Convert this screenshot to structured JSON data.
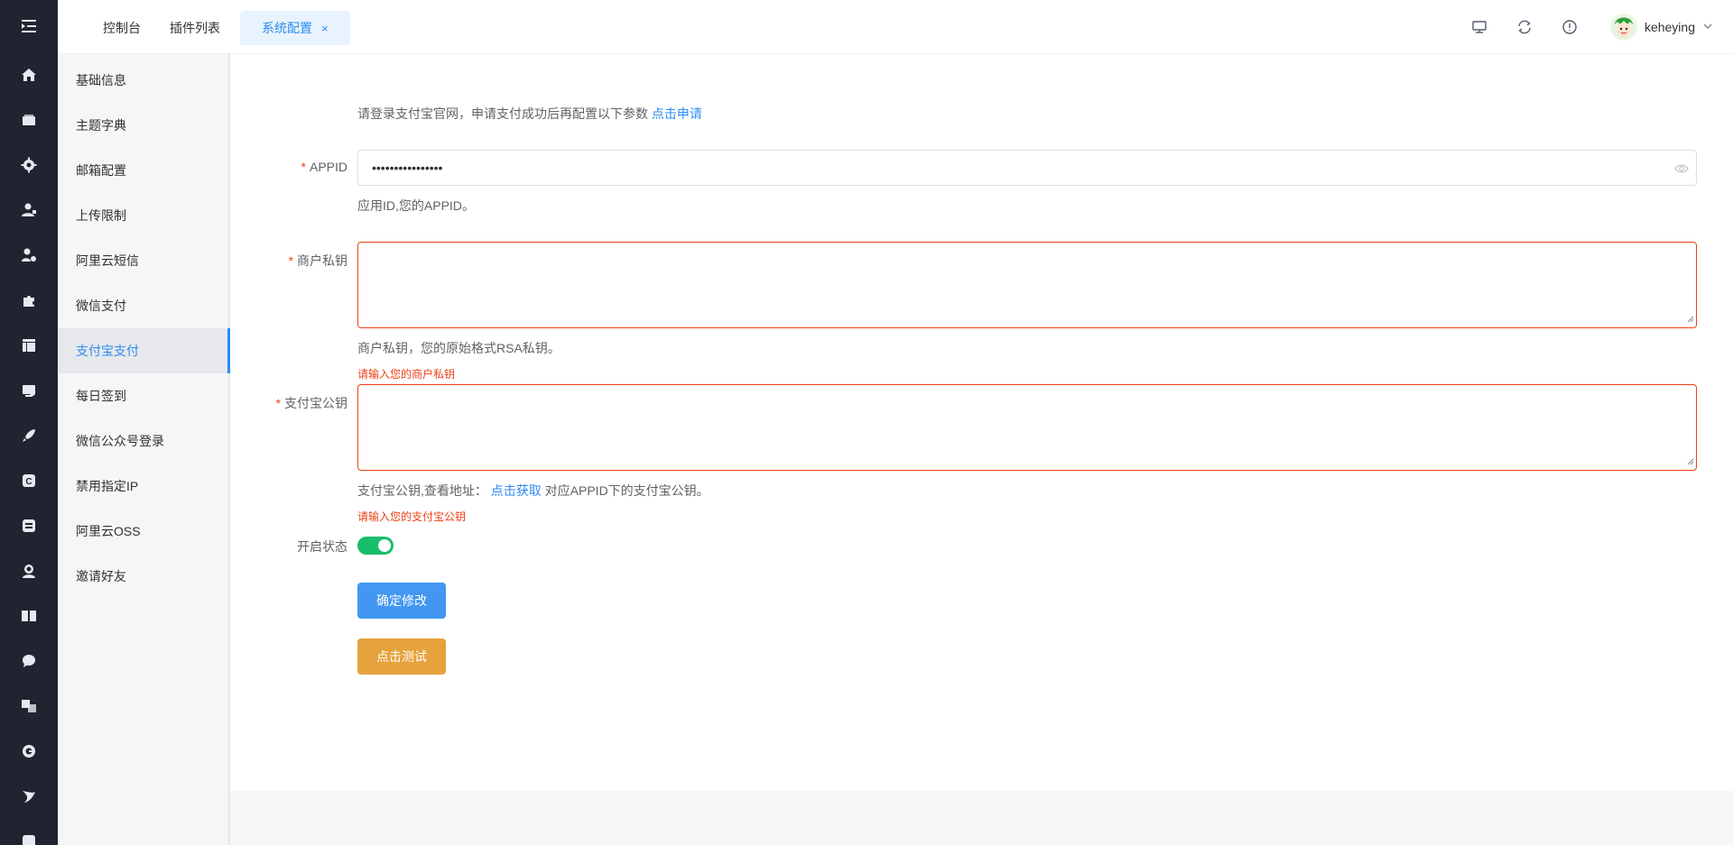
{
  "header": {
    "tabs": [
      {
        "label": "控制台"
      },
      {
        "label": "插件列表"
      },
      {
        "label": "系统配置",
        "close": "×"
      }
    ],
    "user": {
      "name": "keheying"
    },
    "icons": [
      "monitor-icon",
      "refresh-icon",
      "info-icon",
      "avatar",
      "chevron-down-icon"
    ]
  },
  "rail": {
    "icons": [
      "menu-fold-icon",
      "home-icon",
      "wallet-icon",
      "gear-icon",
      "user-icon",
      "user-settings-icon",
      "puzzle-icon",
      "layout-icon",
      "shop-icon",
      "rocket-icon",
      "copyright-icon",
      "blog-icon",
      "support-icon",
      "book-icon",
      "chat-icon",
      "translate-icon",
      "g-icon",
      "bird-icon",
      "code-icon"
    ]
  },
  "subnav": {
    "items": [
      {
        "label": "基础信息"
      },
      {
        "label": "主题字典"
      },
      {
        "label": "邮箱配置"
      },
      {
        "label": "上传限制"
      },
      {
        "label": "阿里云短信"
      },
      {
        "label": "微信支付"
      },
      {
        "label": "支付宝支付",
        "active": true
      },
      {
        "label": "每日签到"
      },
      {
        "label": "微信公众号登录"
      },
      {
        "label": "禁用指定IP"
      },
      {
        "label": "阿里云OSS"
      },
      {
        "label": "邀请好友"
      }
    ]
  },
  "form": {
    "notice": "请登录支付宝官网，申请支付成功后再配置以下参数",
    "notice_link": "点击申请",
    "required_mark": "*",
    "appid": {
      "label": "APPID",
      "value": "••••••••••••••••",
      "hint": "应用ID,您的APPID。"
    },
    "private_key": {
      "label": "商户私钥",
      "hint": "商户私钥，您的原始格式RSA私钥。",
      "error": "请输入您的商户私钥"
    },
    "public_key": {
      "label": "支付宝公钥",
      "hint_prefix": "支付宝公钥,查看地址：",
      "hint_link": "点击获取",
      "hint_suffix": "对应APPID下的支付宝公钥。",
      "error": "请输入您的支付宝公钥"
    },
    "status": {
      "label": "开启状态",
      "on": true
    },
    "submit_label": "确定修改",
    "test_label": "点击测试"
  },
  "colors": {
    "rail_bg": "#1f2430",
    "primary": "#2d8cf0",
    "error": "#ed4014",
    "success": "#19be6b",
    "warning": "#e6a23c"
  }
}
